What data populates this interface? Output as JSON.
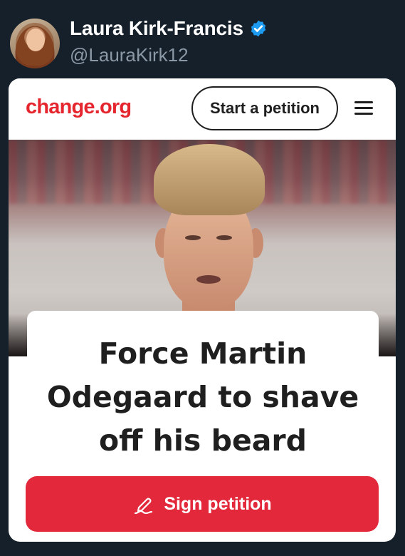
{
  "tweet": {
    "display_name": "Laura Kirk-Francis",
    "handle": "@LauraKirk12",
    "verified_icon": "verified-badge-icon",
    "verified_color": "#1d9bf0"
  },
  "petition_card": {
    "logo": "change.org",
    "brand_color": "#e5262f",
    "start_button_label": "Start a petition",
    "menu_icon": "hamburger-menu-icon",
    "title": "Force Martin Odegaard to shave off his beard",
    "sign_button_label": "Sign petition",
    "sign_button_icon": "pen-signature-icon",
    "sign_button_color": "#e2283a"
  }
}
